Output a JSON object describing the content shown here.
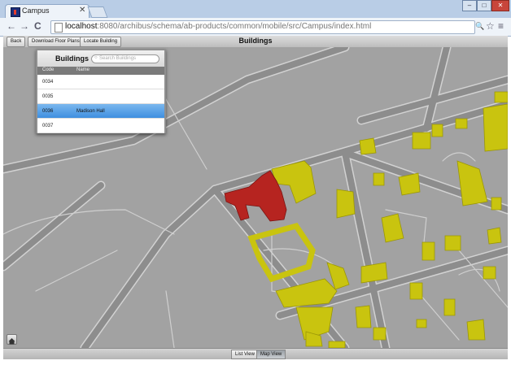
{
  "browser": {
    "tab_title": "Campus",
    "tab_close": "✕",
    "url_host": "localhost",
    "url_rest": ":8080/archibus/schema/ab-products/common/mobile/src/Campus/index.html",
    "window_min": "–",
    "window_max": "□",
    "window_close": "✕",
    "back": "←",
    "forward": "→",
    "reload": "C",
    "zoom_icon": "🔍",
    "star_icon": "☆",
    "menu_icon": "≡"
  },
  "toolbar": {
    "back_label": "Back",
    "download_label": "Download Floor Plans",
    "locate_label": "Locate Building",
    "title": "Buildings"
  },
  "panel": {
    "title": "Buildings",
    "search_placeholder": "Search Buildings",
    "columns": [
      "Code",
      "Name"
    ],
    "rows": [
      {
        "code": "0034",
        "name": "",
        "selected": false
      },
      {
        "code": "0035",
        "name": "",
        "selected": false
      },
      {
        "code": "0036",
        "name": "Madison Hall",
        "selected": true
      },
      {
        "code": "0037",
        "name": "",
        "selected": false
      }
    ]
  },
  "bottom": {
    "list_view_label": "List View",
    "map_view_label": "Map View",
    "active": "Map View"
  },
  "colors": {
    "map_bg": "#a2a2a2",
    "road": "#8c8c8c",
    "road_edge": "#d6d6d6",
    "building": "#cbc612",
    "selected_building": "#b62420",
    "selected_row": "#4a98e4"
  }
}
